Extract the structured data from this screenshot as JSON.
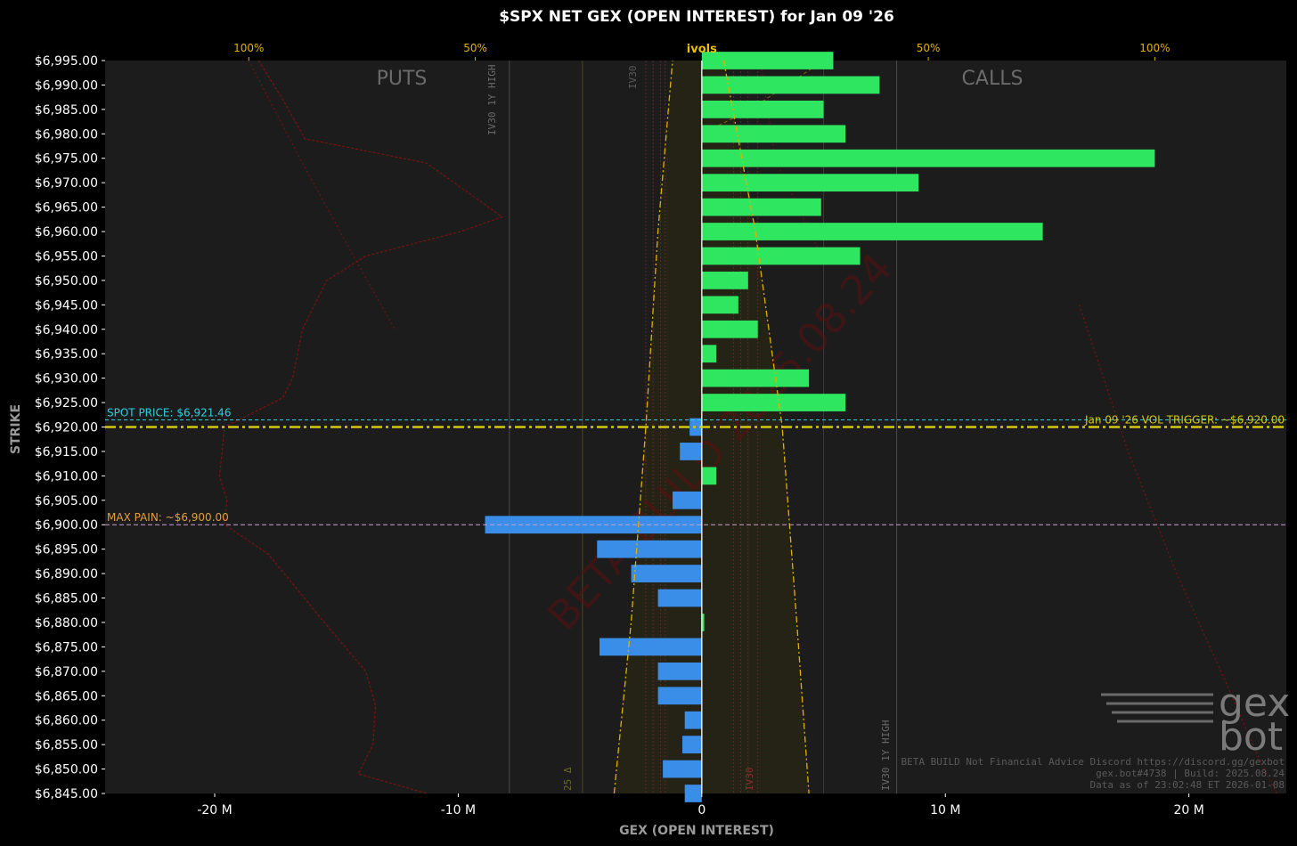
{
  "chart_data": {
    "type": "bar",
    "orientation": "horizontal",
    "title": "$SPX NET GEX (OPEN INTEREST) for Jan 09 '26",
    "xlabel": "GEX (OPEN INTEREST)",
    "ylabel": "STRIKE",
    "xlim": [
      -24.5,
      24
    ],
    "x_ticks": [
      -20,
      -10,
      0,
      10,
      20
    ],
    "x_tick_labels": [
      "-20 M",
      "-10 M",
      "0",
      "10 M",
      "20 M"
    ],
    "top_axis": {
      "label": "ivols",
      "ticks": [
        "100%",
        "50%",
        "50%",
        "100%"
      ]
    },
    "side_labels": {
      "left": "PUTS",
      "right": "CALLS"
    },
    "strikes": [
      6995,
      6990,
      6985,
      6980,
      6975,
      6970,
      6965,
      6960,
      6955,
      6950,
      6945,
      6940,
      6935,
      6930,
      6925,
      6920,
      6915,
      6910,
      6905,
      6900,
      6895,
      6890,
      6885,
      6880,
      6875,
      6870,
      6865,
      6860,
      6855,
      6850,
      6845
    ],
    "strike_labels": [
      "$6,995.00",
      "$6,990.00",
      "$6,985.00",
      "$6,980.00",
      "$6,975.00",
      "$6,970.00",
      "$6,965.00",
      "$6,960.00",
      "$6,955.00",
      "$6,950.00",
      "$6,945.00",
      "$6,940.00",
      "$6,935.00",
      "$6,930.00",
      "$6,925.00",
      "$6,920.00",
      "$6,915.00",
      "$6,910.00",
      "$6,905.00",
      "$6,900.00",
      "$6,895.00",
      "$6,890.00",
      "$6,885.00",
      "$6,880.00",
      "$6,875.00",
      "$6,870.00",
      "$6,865.00",
      "$6,860.00",
      "$6,855.00",
      "$6,850.00",
      "$6,845.00"
    ],
    "values": [
      5.4,
      7.3,
      5.0,
      5.9,
      18.6,
      8.9,
      4.9,
      14.0,
      6.5,
      1.9,
      1.5,
      2.3,
      0.6,
      4.4,
      5.9,
      -0.5,
      -0.9,
      0.6,
      -1.2,
      -8.9,
      -4.3,
      -2.9,
      -1.8,
      0.1,
      -4.2,
      -1.8,
      -1.8,
      -0.7,
      -0.8,
      -1.6,
      -0.7
    ],
    "colors": {
      "calls": "#2ee65f",
      "puts": "#3a8ee8",
      "vol_trigger": "#d4c810",
      "spot": "#2bd0e0",
      "max_pain": "#e0a040",
      "ivols": "#e0b000"
    },
    "annotations": {
      "spot_price_label": "SPOT PRICE: $6,921.46",
      "spot_price": 6921.46,
      "vol_trigger_label": "Jan 09 '26 VOL TRIGGER: ~$6,920.00",
      "vol_trigger": 6920,
      "max_pain_label": "MAX PAIN: ~$6,900.00",
      "max_pain": 6900,
      "iv30_label": "IV30 1Y HIGH",
      "iv30_short": "IV30",
      "delta_label": "25 Δ"
    },
    "watermark": "BETA BUILD 2025.08.24",
    "footer": [
      "BETA BUILD Not Financial Advice Discord https://discord.gg/gexbot",
      "gex.bot#4738 | Build: 2025.08.24",
      "Data as of 23:02:48 ET 2026-01-08"
    ],
    "logo": [
      "gex",
      "bot"
    ]
  }
}
